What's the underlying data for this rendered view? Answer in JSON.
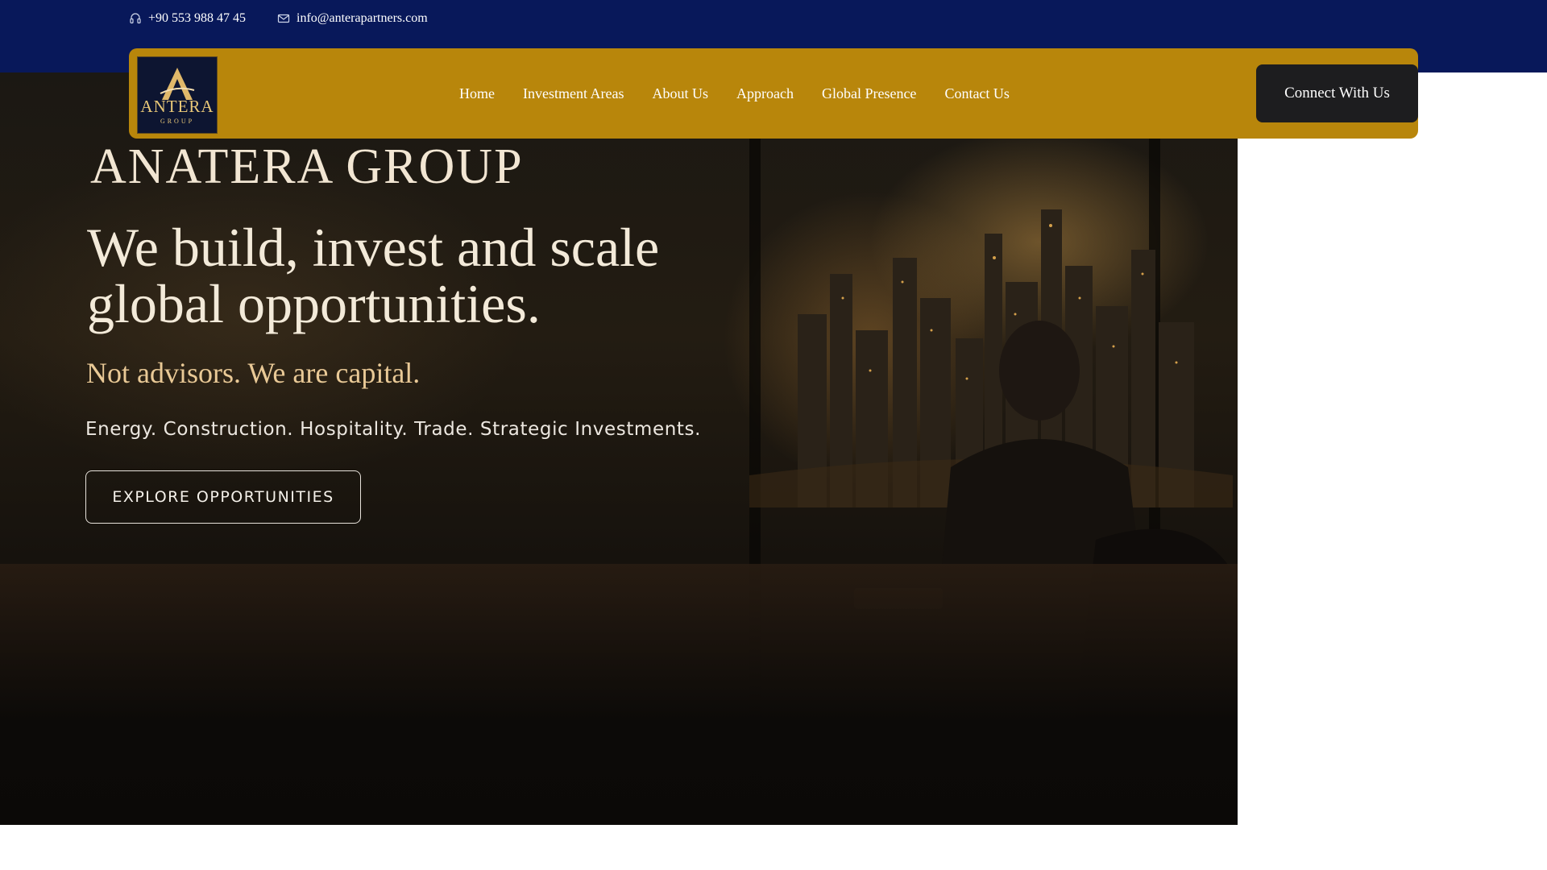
{
  "topbar": {
    "phone": "+90 553 988 47 45",
    "email": "info@anterapartners.com"
  },
  "nav": {
    "logo_word": "ANTERA",
    "logo_sub": "GROUP",
    "items": [
      {
        "label": "Home"
      },
      {
        "label": "Investment Areas"
      },
      {
        "label": "About Us"
      },
      {
        "label": "Approach"
      },
      {
        "label": "Global Presence"
      },
      {
        "label": "Contact Us"
      }
    ],
    "cta": "Connect With Us"
  },
  "hero": {
    "brand": "ANATERA GROUP",
    "headline": "We build, invest and scale global opportunities.",
    "tagline": "Not advisors. We are capital.",
    "sectors": "Energy. Construction. Hospitality. Trade. Strategic Investments.",
    "button": "EXPLORE OPPORTUNITIES"
  },
  "colors": {
    "topbar": "#08185a",
    "navbar": "#b8860b",
    "cta": "#1d1d1f",
    "tagline": "#e9c996"
  },
  "icons": [
    "headset-icon",
    "mail-icon"
  ]
}
